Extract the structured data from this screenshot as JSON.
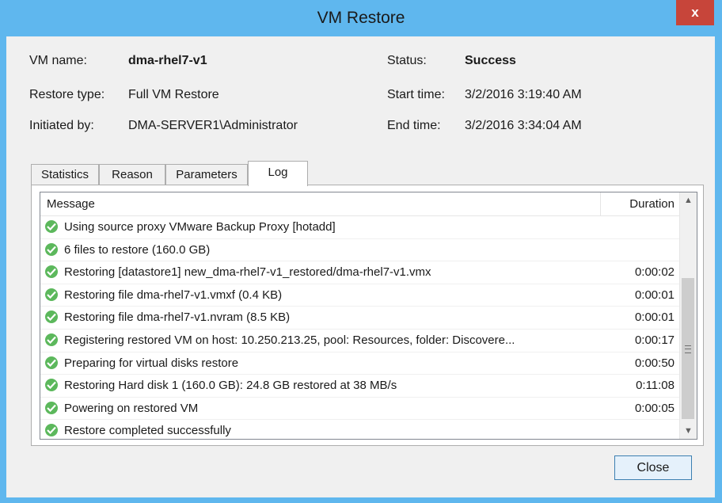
{
  "window": {
    "title": "VM Restore",
    "close_glyph": "x"
  },
  "summary": {
    "vm_name_label": "VM name:",
    "vm_name": "dma-rhel7-v1",
    "restore_type_label": "Restore type:",
    "restore_type": "Full VM Restore",
    "initiated_by_label": "Initiated by:",
    "initiated_by": "DMA-SERVER1\\Administrator",
    "status_label": "Status:",
    "status": "Success",
    "start_time_label": "Start time:",
    "start_time": "3/2/2016 3:19:40 AM",
    "end_time_label": "End time:",
    "end_time": "3/2/2016 3:34:04 AM"
  },
  "tabs": [
    {
      "label": "Statistics"
    },
    {
      "label": "Reason"
    },
    {
      "label": "Parameters"
    },
    {
      "label": "Log",
      "active": true
    }
  ],
  "log": {
    "columns": {
      "message": "Message",
      "duration": "Duration"
    },
    "rows": [
      {
        "message": "Using source proxy VMware Backup Proxy [hotadd]",
        "duration": ""
      },
      {
        "message": "6 files to restore (160.0 GB)",
        "duration": ""
      },
      {
        "message": "Restoring [datastore1] new_dma-rhel7-v1_restored/dma-rhel7-v1.vmx",
        "duration": "0:00:02"
      },
      {
        "message": "Restoring file dma-rhel7-v1.vmxf (0.4 KB)",
        "duration": "0:00:01"
      },
      {
        "message": "Restoring file dma-rhel7-v1.nvram (8.5 KB)",
        "duration": "0:00:01"
      },
      {
        "message": "Registering restored VM on host: 10.250.213.25, pool: Resources, folder: Discovere...",
        "duration": "0:00:17"
      },
      {
        "message": "Preparing for virtual disks restore",
        "duration": "0:00:50"
      },
      {
        "message": "Restoring Hard disk 1 (160.0 GB): 24.8 GB restored at 38 MB/s",
        "duration": "0:11:08"
      },
      {
        "message": "Powering on restored VM",
        "duration": "0:00:05"
      },
      {
        "message": "Restore completed successfully",
        "duration": ""
      }
    ],
    "row_icon": "success-check-icon"
  },
  "buttons": {
    "close": "Close"
  },
  "colors": {
    "accent": "#1e8fd6",
    "success": "#5cb85c",
    "close_red": "#c7453a"
  }
}
